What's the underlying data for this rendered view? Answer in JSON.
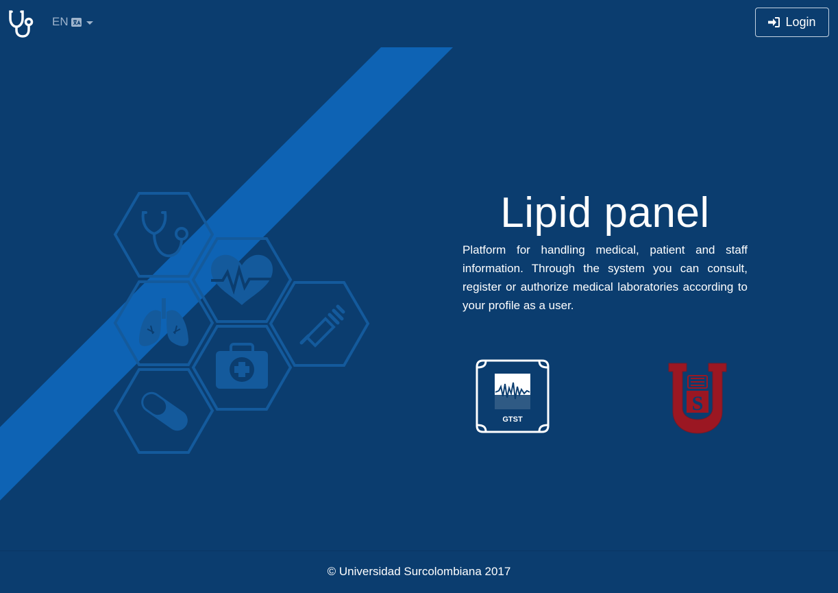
{
  "nav": {
    "language_label": "EN",
    "language_icon": "translate-globe-icon",
    "login_label": "Login",
    "login_icon": "sign-in-icon",
    "brand_icon": "stethoscope-icon"
  },
  "hero": {
    "title": "Lipid panel",
    "description": "Platform for handling medical, patient and staff information. Through the system you can consult, register or authorize medical laboratories according to your profile as a user.",
    "illustration_icons": [
      "stethoscope-icon",
      "heartbeat-icon",
      "lungs-icon",
      "syringe-icon",
      "first-aid-kit-icon",
      "pill-icon"
    ]
  },
  "partners": {
    "gtst_label": "GTST",
    "usco_letter_u": "U",
    "usco_letter_s": "S"
  },
  "footer": {
    "copyright": "© Universidad Surcolombiana 2017"
  },
  "colors": {
    "background": "#0b3d6f",
    "stripe": "#0e63b4",
    "hex_outline": "#145a9c",
    "usco_red": "#9b1722"
  }
}
